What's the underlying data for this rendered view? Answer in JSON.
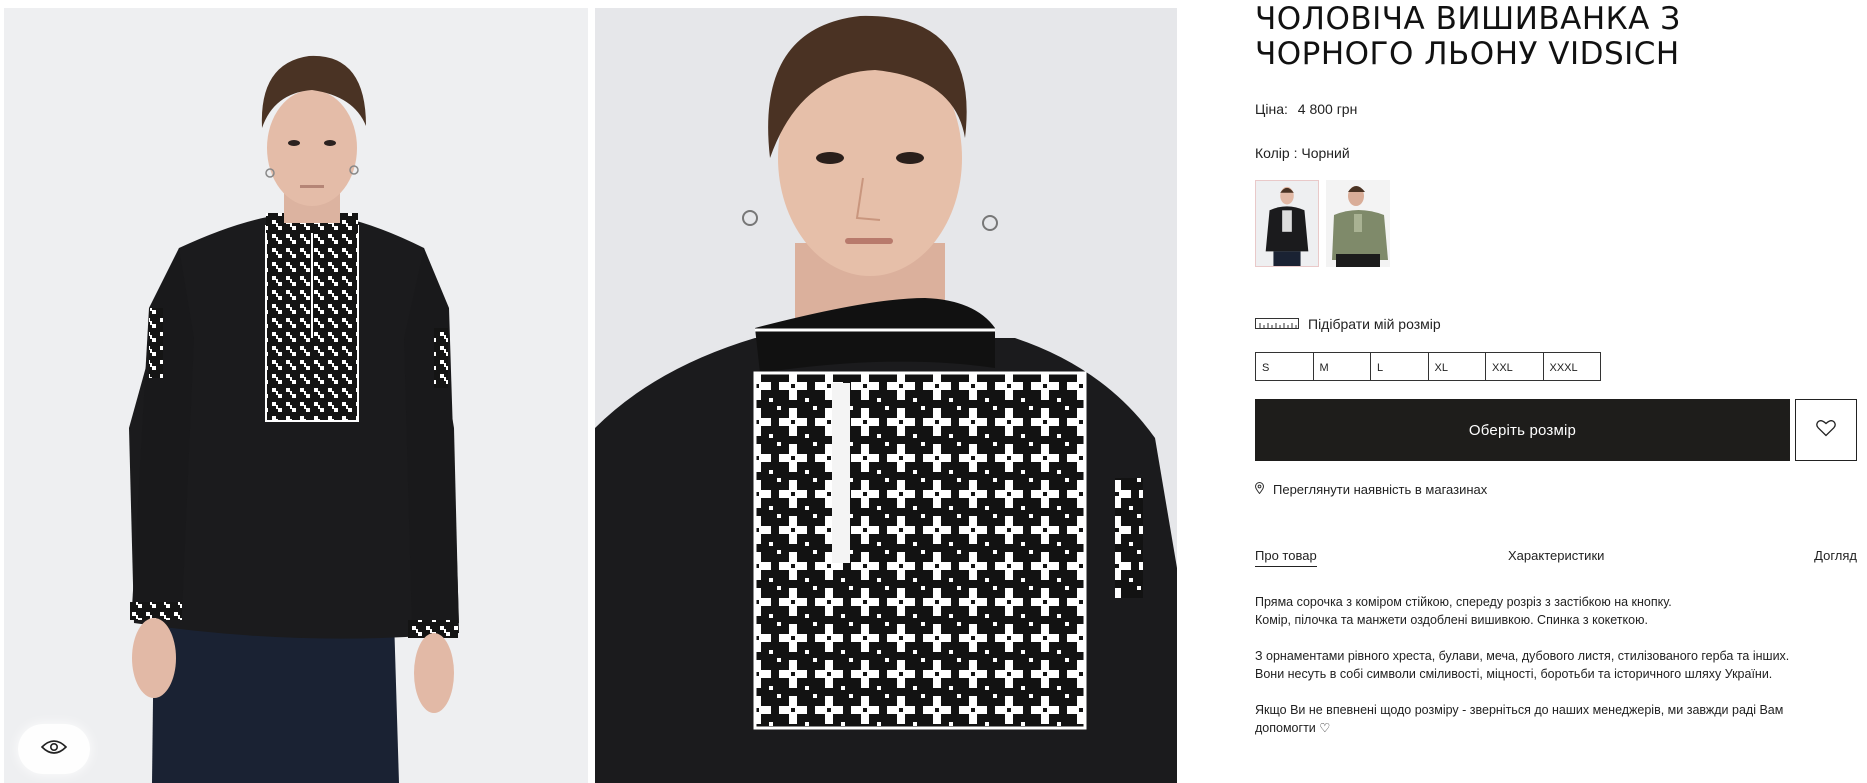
{
  "product": {
    "title": "Чоловіча вишиванка з чорного льону Vidsich",
    "price_label": "Ціна:",
    "price_value": "4 800 грн",
    "color_label": "Колір : Чорний"
  },
  "gallery": {
    "view_icon": "eye-icon",
    "colors": {
      "background": "#eeeff1",
      "shirt": "#1b1b1d",
      "embroidery": "#ffffff",
      "jeans": "#1a2233"
    }
  },
  "swatches": [
    {
      "name": "black",
      "color": "#1b1b1d"
    },
    {
      "name": "olive",
      "color": "#7f8a6a"
    }
  ],
  "size_guide": {
    "label": "Підібрати мій розмір",
    "icon": "ruler-icon"
  },
  "sizes": [
    "S",
    "M",
    "L",
    "XL",
    "XXL",
    "XXXL"
  ],
  "actions": {
    "choose_size": "Оберіть розмір",
    "favorite_icon": "heart-icon",
    "stores_label": "Переглянути наявність в магазинах",
    "stores_icon": "location-pin-icon"
  },
  "tabs": {
    "about": "Про товар",
    "specs": "Характеристики",
    "care": "Догляд"
  },
  "description": {
    "p1_line1": "Пряма сорочка з коміром стійкою, спереду розріз з застібкою на кнопку.",
    "p1_line2": "Комір, пілочка та манжети оздоблені вишивкою. Спинка з кокеткою.",
    "p2_line1": "З орнаментами рівного хреста, булави, меча, дубового листя, стилізованого герба та інших.",
    "p2_line2": "Вони несуть в собі символи сміливості, міцності, боротьби та історичного шляху України.",
    "p3_line1": "Якщо Ви не впевнені щодо розміру - зверніться до наших менеджерів, ми завжди раді Вам",
    "p3_line2": "допомогти ♡"
  }
}
